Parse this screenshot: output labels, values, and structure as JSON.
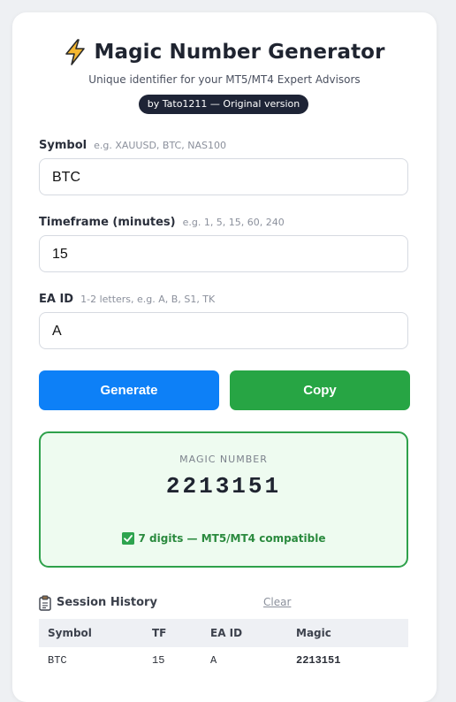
{
  "header": {
    "title": "Magic Number Generator",
    "subtitle": "Unique identifier for your MT5/MT4 Expert Advisors",
    "badge": "by Tato1211 — Original version"
  },
  "fields": {
    "symbol": {
      "label": "Symbol",
      "hint": "e.g. XAUUSD, BTC, NAS100",
      "value": "BTC"
    },
    "timeframe": {
      "label": "Timeframe (minutes)",
      "hint": "e.g. 1, 5, 15, 60, 240",
      "value": "15"
    },
    "ea_id": {
      "label": "EA ID",
      "hint": "1-2 letters, e.g. A, B, S1, TK",
      "value": "A"
    }
  },
  "buttons": {
    "generate": "Generate",
    "copy": "Copy"
  },
  "result": {
    "label": "MAGIC NUMBER",
    "value": "2213151",
    "status": "7 digits — MT5/MT4 compatible"
  },
  "history": {
    "title": "Session History",
    "clear": "Clear",
    "columns": [
      "Symbol",
      "TF",
      "EA ID",
      "Magic"
    ],
    "rows": [
      [
        "BTC",
        "15",
        "A",
        "2213151"
      ]
    ]
  },
  "colors": {
    "primary": "#0d80f7",
    "success": "#27a544",
    "badge_bg": "#1e2436",
    "icons": [
      "lightning-icon",
      "check-icon",
      "clipboard-icon"
    ]
  }
}
